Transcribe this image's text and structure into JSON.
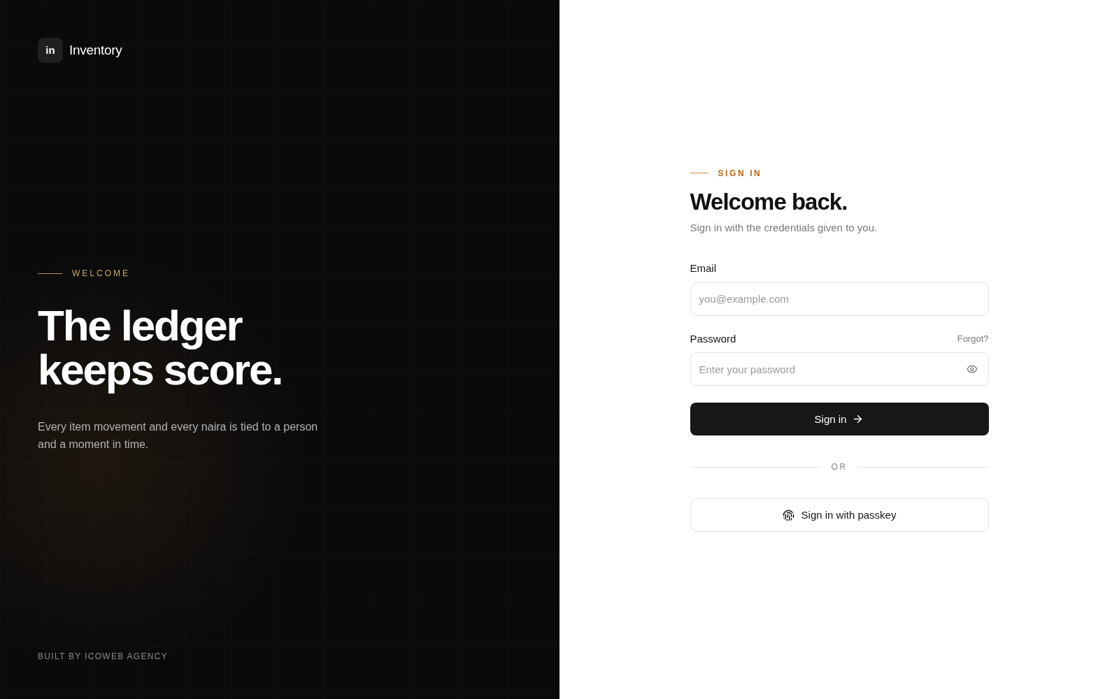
{
  "brand": {
    "logo_text": "in",
    "name": "Inventory"
  },
  "hero": {
    "eyebrow": "WELCOME",
    "title": "The ledger keeps score.",
    "description": "Every item movement and every naira is tied to a person and a moment in time."
  },
  "footer": "BUILT BY ICOWEB AGENCY",
  "form": {
    "eyebrow": "SIGN IN",
    "title": "Welcome back.",
    "subtitle": "Sign in with the credentials given to you.",
    "fields": [
      {
        "kind": "email",
        "label": "Email",
        "placeholder": "you@example.com"
      },
      {
        "kind": "password",
        "label": "Password",
        "placeholder": "Enter your password",
        "link": "Forgot?"
      }
    ],
    "submit": "Sign in",
    "divider": "OR",
    "passkey": "Sign in with passkey"
  }
}
